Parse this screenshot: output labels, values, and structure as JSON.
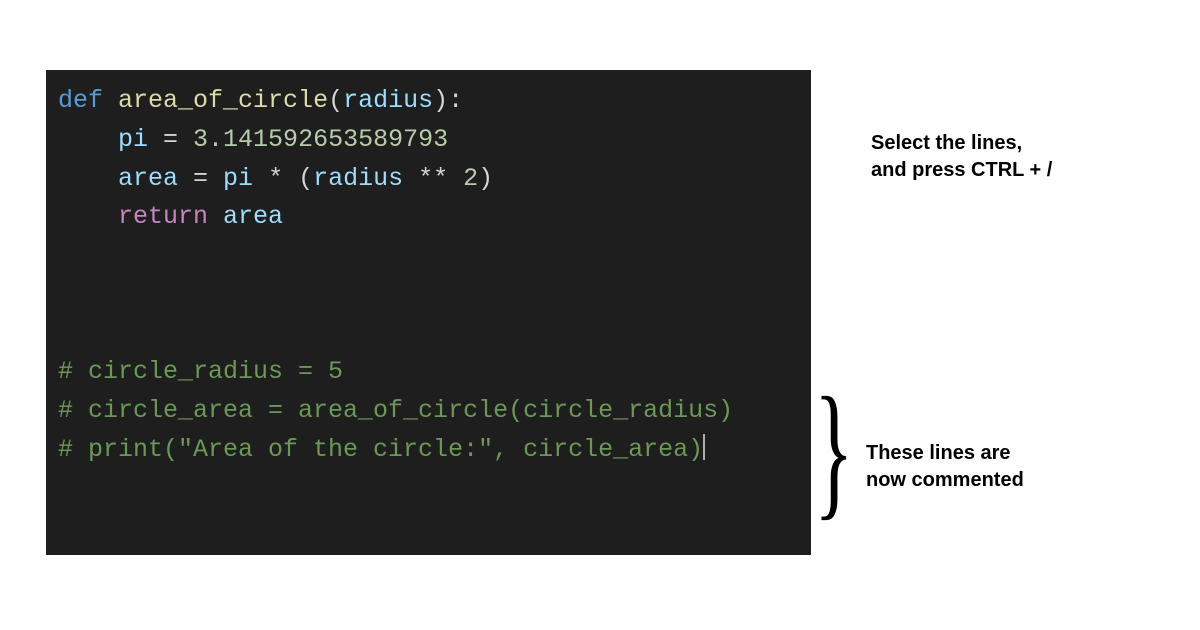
{
  "code": {
    "l1": {
      "def": "def",
      "fn": "area_of_circle",
      "open": "(",
      "param": "radius",
      "close": "):"
    },
    "l2": {
      "var": "pi",
      "eq": " = ",
      "num": "3.141592653589793"
    },
    "l3": {
      "var": "area",
      "eq": " = ",
      "pi": "pi",
      "mul": " * (",
      "rad": "radius",
      "pow": " ** ",
      "two": "2",
      "end": ")"
    },
    "l4": {
      "ret": "return",
      "sp": " ",
      "var": "area"
    },
    "c1": "# circle_radius = 5",
    "c2": "# circle_area = area_of_circle(circle_radius)",
    "c3": "# print(\"Area of the circle:\", circle_area)"
  },
  "annotations": {
    "top_line1": "Select the lines,",
    "top_line2": "and press CTRL + /",
    "bottom_line1": "These lines are",
    "bottom_line2": "now commented"
  }
}
